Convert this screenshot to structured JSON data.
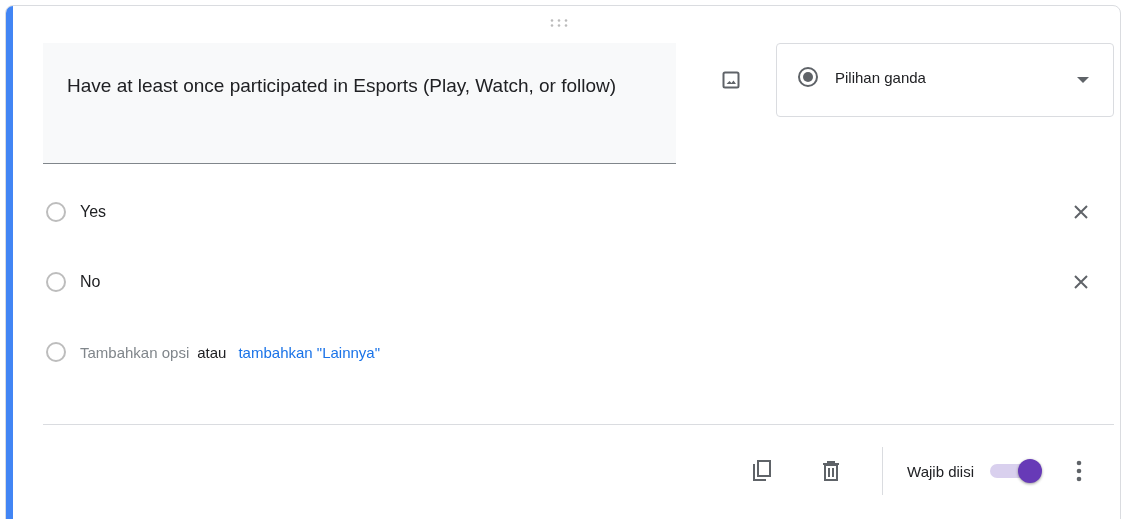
{
  "question": {
    "title": "Have at least once participated in Esports (Play, Watch, or follow)",
    "type_label": "Pilihan ganda"
  },
  "options": [
    {
      "label": "Yes",
      "selected": false
    },
    {
      "label": "No",
      "selected": false
    }
  ],
  "add_option": {
    "placeholder": "Tambahkan opsi",
    "separator": "atau",
    "link": "tambahkan \"Lainnya\"",
    "selected": false
  },
  "footer": {
    "required_label": "Wajib diisi",
    "required": true
  }
}
